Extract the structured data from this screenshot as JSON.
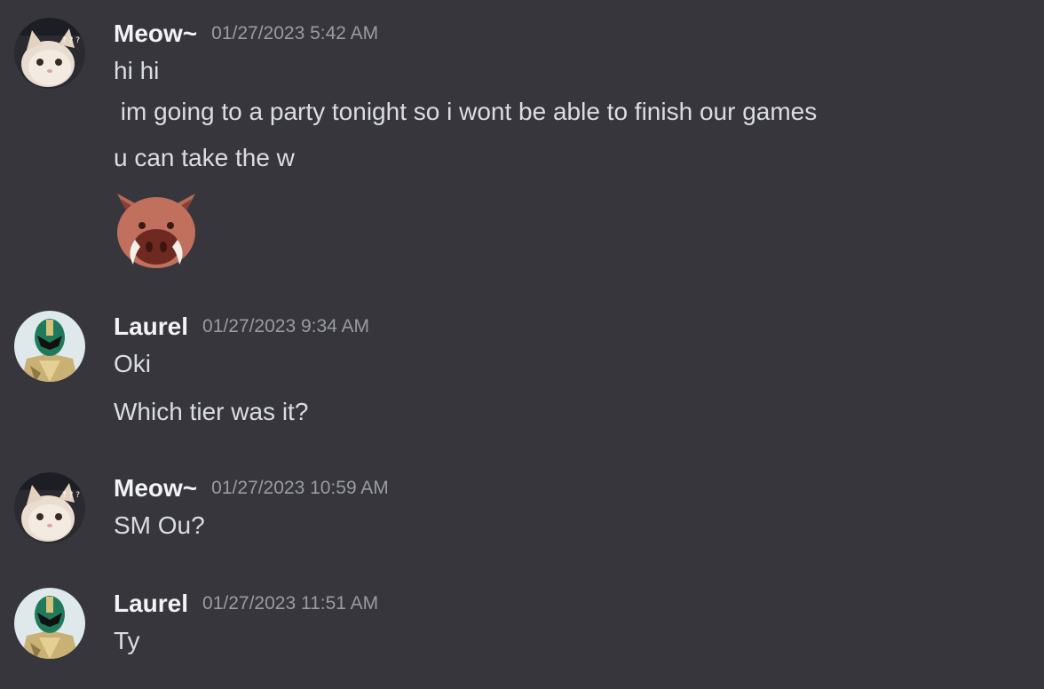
{
  "messages": [
    {
      "author": "Meow~",
      "timestamp": "01/27/2023 5:42 AM",
      "avatar_icon": "cat-avatar",
      "lines": [
        "hi hi",
        " im going to a party tonight so i wont be able to finish our games",
        "u can take the w"
      ],
      "emoji": "boar-emoji"
    },
    {
      "author": "Laurel",
      "timestamp": "01/27/2023 9:34 AM",
      "avatar_icon": "green-ranger-avatar",
      "lines": [
        "Oki",
        "Which tier was it?"
      ]
    },
    {
      "author": "Meow~",
      "timestamp": "01/27/2023 10:59 AM",
      "avatar_icon": "cat-avatar",
      "lines": [
        "SM Ou?"
      ]
    },
    {
      "author": "Laurel",
      "timestamp": "01/27/2023 11:51 AM",
      "avatar_icon": "green-ranger-avatar",
      "lines": [
        "Ty"
      ]
    }
  ],
  "colors": {
    "background": "#36363c",
    "username": "#f2f3f5",
    "timestamp": "#9a9ca3",
    "message": "#dbdee1"
  }
}
